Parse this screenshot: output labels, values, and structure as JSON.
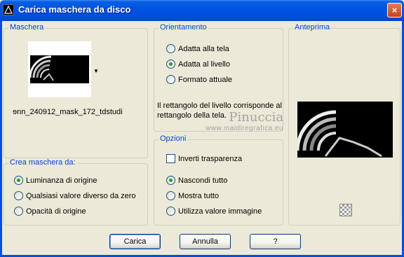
{
  "window": {
    "title": "Carica maschera da disco",
    "close_label": "×"
  },
  "mask_group": {
    "legend": "Maschera",
    "filename": "ɘnn_240912_mask_172_tdstudi"
  },
  "orientation_group": {
    "legend": "Orientamento",
    "options": [
      "Adatta alla tela",
      "Adatta al livello",
      "Formato attuale"
    ],
    "selected_index": 1,
    "note": "Il rettangolo del livello corrisponde al rettangolo della tela."
  },
  "preview_group": {
    "legend": "Anteprima"
  },
  "create_group": {
    "legend": "Crea maschera da:",
    "options": [
      "Luminanza di origine",
      "Qualsiasi valore diverso da zero",
      "Opacità di origine"
    ],
    "selected_index": 0
  },
  "options_group": {
    "legend": "Opzioni",
    "invert_label": "Inverti trasparenza",
    "invert_checked": false,
    "options": [
      "Nascondi tutto",
      "Mostra tutto",
      "Utilizza valore immagine"
    ],
    "selected_index": 0
  },
  "watermark": {
    "line1": "Pinuccia",
    "line2": "www.maidiregrafica.eu"
  },
  "buttons": {
    "load": "Carica",
    "cancel": "Annulla",
    "help": "?"
  }
}
